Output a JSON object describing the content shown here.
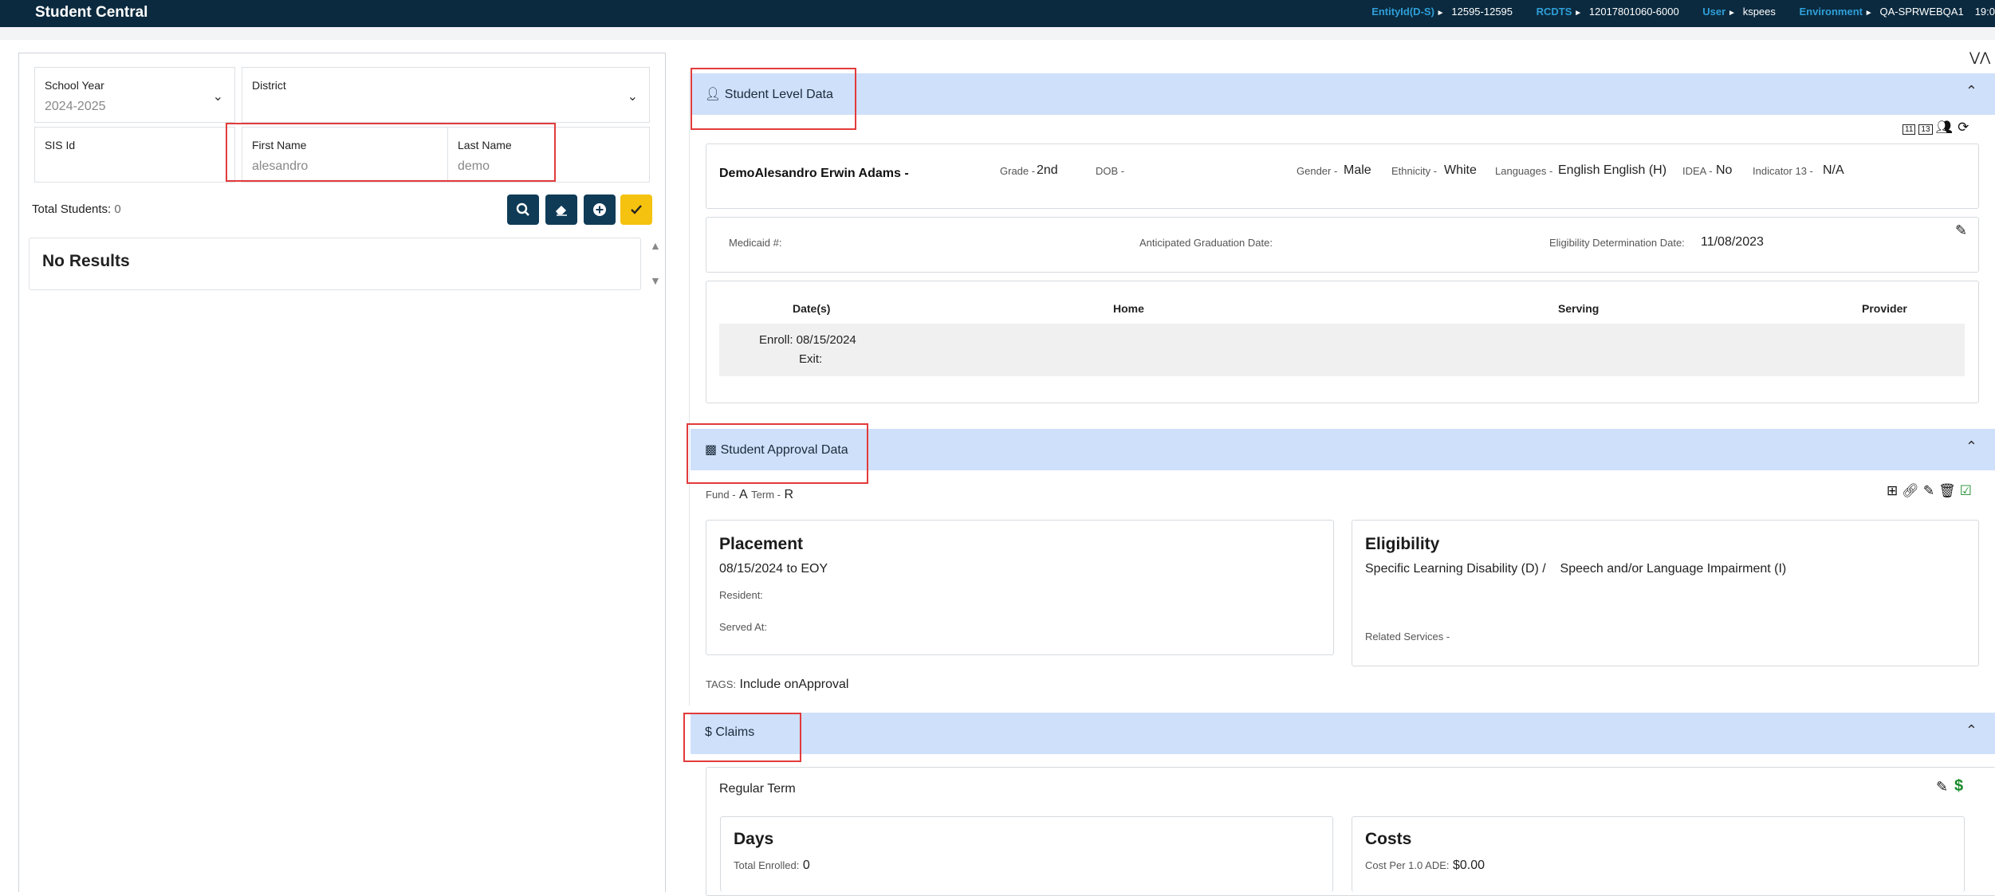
{
  "app": {
    "title": "Student Central"
  },
  "environment": [
    {
      "key": "EntityId(D-S)",
      "value": "12595-12595"
    },
    {
      "key": "RCDTS",
      "value": "12017801060-6000"
    },
    {
      "key": "User",
      "value": "kspees"
    },
    {
      "key": "Environment",
      "value": "QA-SPRWEBQA1"
    },
    {
      "key": "",
      "value": "19:0"
    }
  ],
  "search": {
    "school_year": {
      "label": "School Year",
      "value": "2024-2025"
    },
    "district": {
      "label": "District",
      "value": ""
    },
    "sis_id": {
      "label": "SIS Id",
      "value": ""
    },
    "first_name": {
      "label": "First Name",
      "value": "alesandro"
    },
    "last_name": {
      "label": "Last Name",
      "value": "demo"
    },
    "total_label": "Total Students:",
    "total_value": "0",
    "no_results": "No Results"
  },
  "student_level": {
    "header": "Student Level Data",
    "name": "DemoAlesandro Erwin Adams -",
    "grade_label": "Grade -",
    "grade": "2nd",
    "dob_label": "DOB -",
    "dob": "",
    "gender_label": "Gender -",
    "gender": "Male",
    "ethnicity_label": "Ethnicity -",
    "ethnicity": "White",
    "languages_label": "Languages -",
    "languages": "English English (H)",
    "idea_label": "IDEA -",
    "idea": "No",
    "indicator_label": "Indicator 13 -",
    "indicator": "N/A",
    "medicaid_label": "Medicaid #:",
    "grad_label": "Anticipated Graduation Date:",
    "elig_date_label": "Eligibility Determination Date:",
    "elig_date": "11/08/2023",
    "table_headers": [
      "Date(s)",
      "Home",
      "Serving",
      "Provider"
    ],
    "enroll": "Enroll: 08/15/2024",
    "exit": "Exit:",
    "icon_11": "11",
    "icon_13": "13"
  },
  "approval": {
    "header": "Student Approval Data",
    "fund_label": "Fund -",
    "fund": "A",
    "term_label": "Term -",
    "term": "R",
    "placement_title": "Placement",
    "placement_dates": "08/15/2024 to EOY",
    "resident_label": "Resident:",
    "served_label": "Served At:",
    "eligibility_title": "Eligibility",
    "eligibility_value": "Specific Learning Disability (D) /    Speech and/or Language Impairment (I)",
    "related_label": "Related Services -",
    "tags_label": "TAGS:",
    "tags_value": "Include onApproval"
  },
  "claims": {
    "header": "Claims",
    "regular_term": "Regular Term",
    "days_title": "Days",
    "total_enrolled_label": "Total Enrolled:",
    "total_enrolled": "0",
    "costs_title": "Costs",
    "cost_per_label": "Cost Per 1.0 ADE:",
    "cost_per": "$0.00"
  }
}
